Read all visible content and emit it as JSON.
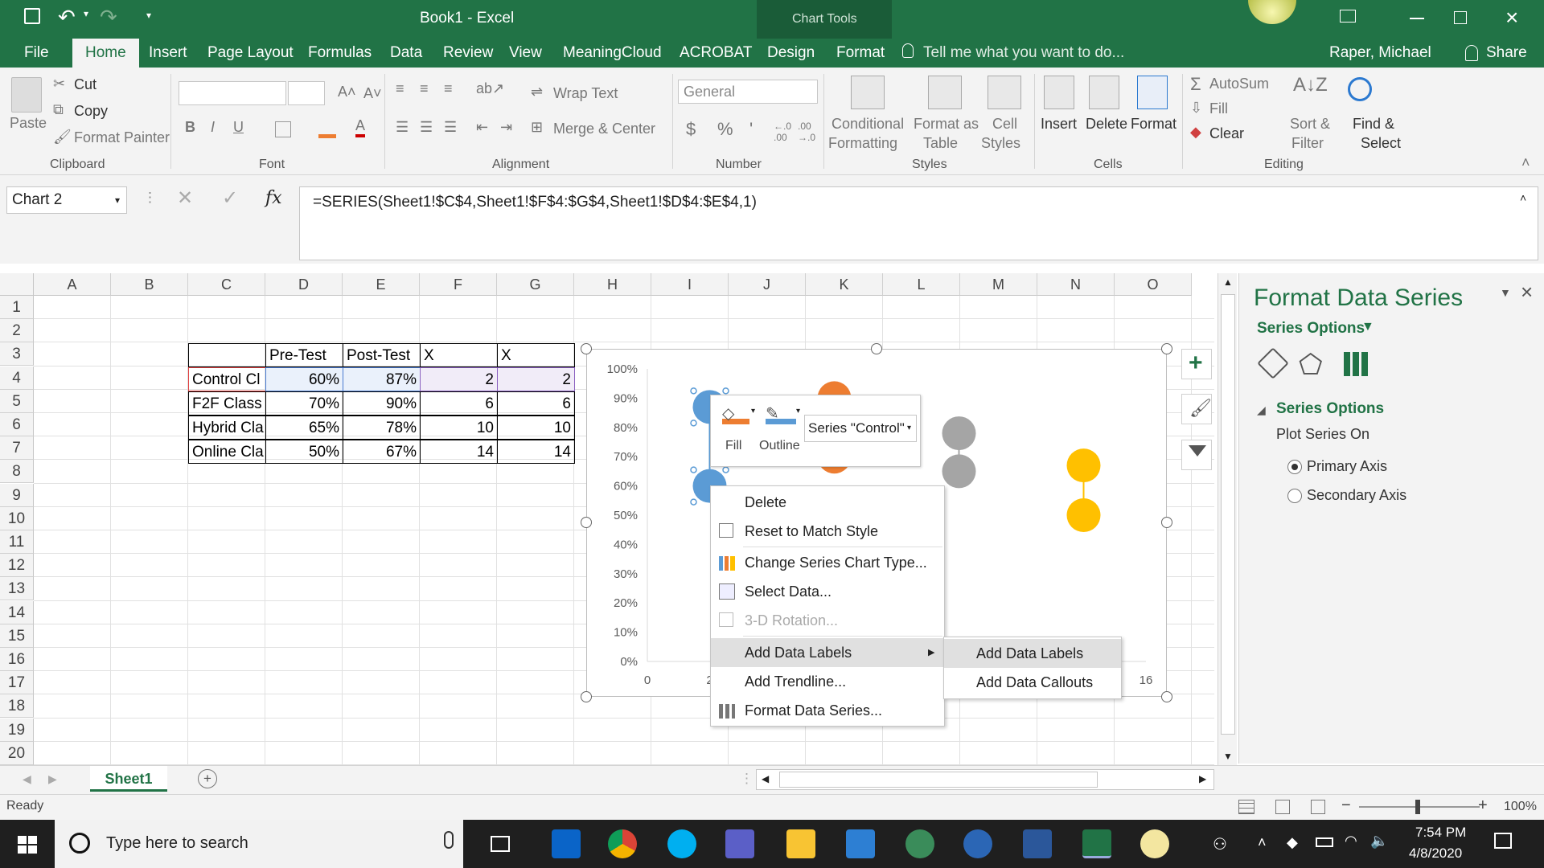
{
  "window": {
    "title": "Book1 - Excel",
    "context_group": "Chart Tools",
    "user": "Raper, Michael",
    "share": "Share"
  },
  "tabs": [
    "File",
    "Home",
    "Insert",
    "Page Layout",
    "Formulas",
    "Data",
    "Review",
    "View",
    "MeaningCloud",
    "ACROBAT",
    "Design",
    "Format"
  ],
  "tell_me": "Tell me what you want to do...",
  "ribbon": {
    "clipboard": {
      "paste": "Paste",
      "cut": "Cut",
      "copy": "Copy",
      "format_painter": "Format Painter",
      "label": "Clipboard"
    },
    "font": {
      "label": "Font",
      "bold": "B",
      "italic": "I",
      "underline": "U"
    },
    "alignment": {
      "wrap": "Wrap Text",
      "merge": "Merge & Center",
      "label": "Alignment"
    },
    "number": {
      "format": "General",
      "label": "Number",
      "currency": "$",
      "percent": "%",
      "comma": "'"
    },
    "styles": {
      "cond1": "Conditional",
      "cond2": "Formatting",
      "fmt1": "Format as",
      "fmt2": "Table",
      "cell1": "Cell",
      "cell2": "Styles",
      "label": "Styles"
    },
    "cells": {
      "insert": "Insert",
      "delete": "Delete",
      "format": "Format",
      "label": "Cells"
    },
    "editing": {
      "autosum": "AutoSum",
      "fill": "Fill",
      "clear": "Clear",
      "sort1": "Sort &",
      "sort2": "Filter",
      "find1": "Find &",
      "find2": "Select",
      "label": "Editing"
    }
  },
  "namebox": "Chart 2",
  "fx": "fx",
  "formula": "=SERIES(Sheet1!$C$4,Sheet1!$F$4:$G$4,Sheet1!$D$4:$E$4,1)",
  "columns": [
    "A",
    "B",
    "C",
    "D",
    "E",
    "F",
    "G",
    "H",
    "I",
    "J",
    "K",
    "L",
    "M",
    "N",
    "O"
  ],
  "rows": [
    "1",
    "2",
    "3",
    "4",
    "5",
    "6",
    "7",
    "8",
    "9",
    "10",
    "11",
    "12",
    "13",
    "14",
    "15",
    "16",
    "17",
    "18",
    "19",
    "20"
  ],
  "table": {
    "headers": [
      "",
      "Pre-Test",
      "Post-Test",
      "X",
      "X"
    ],
    "rows": [
      [
        "Control Cl",
        "60%",
        "87%",
        "2",
        "2"
      ],
      [
        "F2F Class",
        "70%",
        "90%",
        "6",
        "6"
      ],
      [
        "Hybrid Cla",
        "65%",
        "78%",
        "10",
        "10"
      ],
      [
        "Online Cla",
        "50%",
        "67%",
        "14",
        "14"
      ]
    ]
  },
  "chart_data": {
    "type": "scatter",
    "y_ticks": [
      "100%",
      "90%",
      "80%",
      "70%",
      "60%",
      "50%",
      "40%",
      "30%",
      "20%",
      "10%",
      "0%"
    ],
    "x_ticks_visible": [
      "0",
      "2",
      "16"
    ],
    "xlim": [
      0,
      16
    ],
    "ylim": [
      0,
      1
    ],
    "series": [
      {
        "name": "Control",
        "color": "#5b9bd5",
        "x": [
          2,
          2
        ],
        "y": [
          0.6,
          0.87
        ]
      },
      {
        "color": "#ed7d31",
        "x": [
          6,
          6
        ],
        "y": [
          0.7,
          0.9
        ]
      },
      {
        "color": "#a5a5a5",
        "x": [
          10,
          10
        ],
        "y": [
          0.65,
          0.78
        ]
      },
      {
        "color": "#ffc000",
        "x": [
          14,
          14
        ],
        "y": [
          0.5,
          0.67
        ]
      }
    ]
  },
  "mini_toolbar": {
    "fill": "Fill",
    "outline": "Outline",
    "series_select": "Series \"Control\""
  },
  "context_menu": [
    "Delete",
    "Reset to Match Style",
    "Change Series Chart Type...",
    "Select Data...",
    "3-D Rotation...",
    "Add Data Labels",
    "Add Trendline...",
    "Format Data Series..."
  ],
  "submenu": [
    "Add Data Labels",
    "Add Data Callouts"
  ],
  "format_pane": {
    "title": "Format Data Series",
    "options_dropdown": "Series Options",
    "section": "Series Options",
    "plot_on": "Plot Series On",
    "primary": "Primary Axis",
    "secondary": "Secondary Axis"
  },
  "sheet_tab": "Sheet1",
  "status": {
    "ready": "Ready",
    "zoom": "100%"
  },
  "taskbar": {
    "search": "Type here to search",
    "time": "7:54 PM",
    "date": "4/8/2020"
  }
}
